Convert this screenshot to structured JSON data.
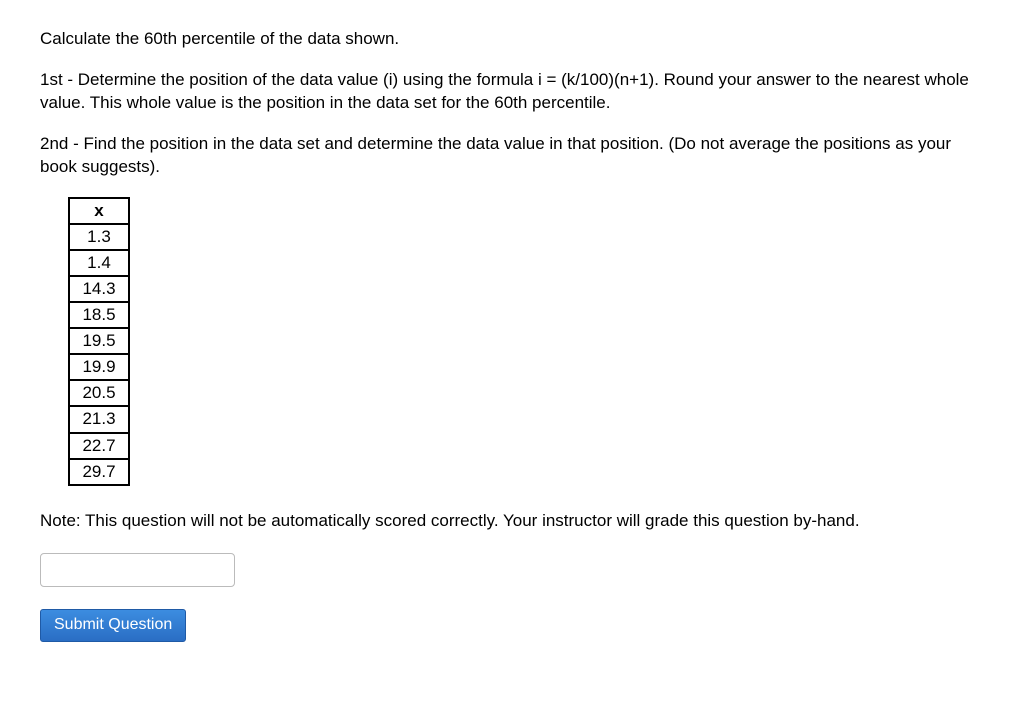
{
  "question": {
    "p1": "Calculate the 60th percentile of the data shown.",
    "p2": "1st - Determine the position of the data value (i) using the formula i = (k/100)(n+1). Round your answer to the nearest whole value. This whole value is the position in the data set for the 60th percentile.",
    "p3": "2nd - Find the position in the data set and determine the data value in that position. (Do not average the positions as your book suggests).",
    "table_header": "x",
    "values": [
      "1.3",
      "1.4",
      "14.3",
      "18.5",
      "19.5",
      "19.9",
      "20.5",
      "21.3",
      "22.7",
      "29.7"
    ],
    "note": "Note: This question will not be automatically scored correctly. Your instructor will grade this question by-hand."
  },
  "answer_input": {
    "value": "",
    "placeholder": ""
  },
  "buttons": {
    "submit": "Submit Question"
  }
}
